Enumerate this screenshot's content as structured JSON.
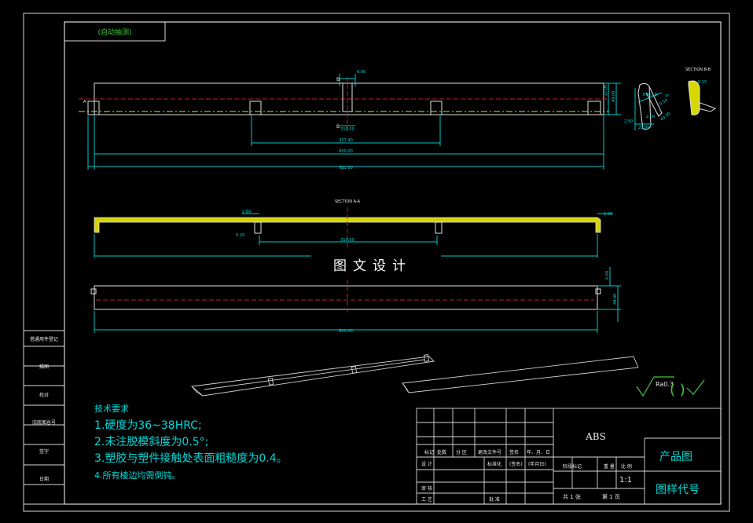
{
  "title_tab": "(自动抽测)",
  "section_bb": "SECTION B-B",
  "section_aa": "SECTION A-A",
  "dims_top": {
    "d1": "6.00",
    "d2": "315.00",
    "d3": "327.40",
    "d4": "600.00",
    "d5": "611.00",
    "d6": "27.00",
    "d7": "49.00"
  },
  "dims_bb": {
    "d1": "0.15",
    "d2": "R90.19",
    "d3": "0.50",
    "d4": "2.00",
    "d5": "2.50",
    "d6": "20.99",
    "d7": "3°",
    "d8": "40.30"
  },
  "dims_aa": {
    "d1": "2.50",
    "d2": "1.00",
    "d3": "0.20",
    "d4": "310.00"
  },
  "dims_bottom": {
    "d1": "6.00",
    "d2": "49.00",
    "d3": "600.00"
  },
  "watermark_text": "图文设计",
  "notes": {
    "heading": "技术要求",
    "items": [
      "1.硬度为36~38HRC;",
      "2.未注脱模斜度为0.5°;",
      "3.塑胶与塑件接触处表面粗糙度为0.4。",
      "4.所有棱边均需倒钝。"
    ]
  },
  "roughness": {
    "label": "Ra0.3",
    "paren": "(  )"
  },
  "left_strip": [
    "借通用件登记",
    "旧底图总号",
    "底图总号",
    "签字",
    "日期"
  ],
  "left_strip_short": [
    "描图",
    "校对"
  ],
  "title_block": {
    "material": "ABS",
    "product": "产品图",
    "drawing_no": "图样代号",
    "scale": "1:1",
    "row_headers": [
      "标记",
      "处数",
      "分 区",
      "更改文件号",
      "签名",
      "年、月、日"
    ],
    "design": "设 计",
    "standardize": "标准化",
    "sign": "(签名)",
    "date": "(年月日)",
    "review": "审 核",
    "process": "工 艺",
    "approve": "批 准",
    "stage_mark": "阶段标记",
    "weight": "重 量",
    "scale_label": "比 例",
    "total_sheets": "共 1 张",
    "sheet_no": "第 1 页"
  }
}
